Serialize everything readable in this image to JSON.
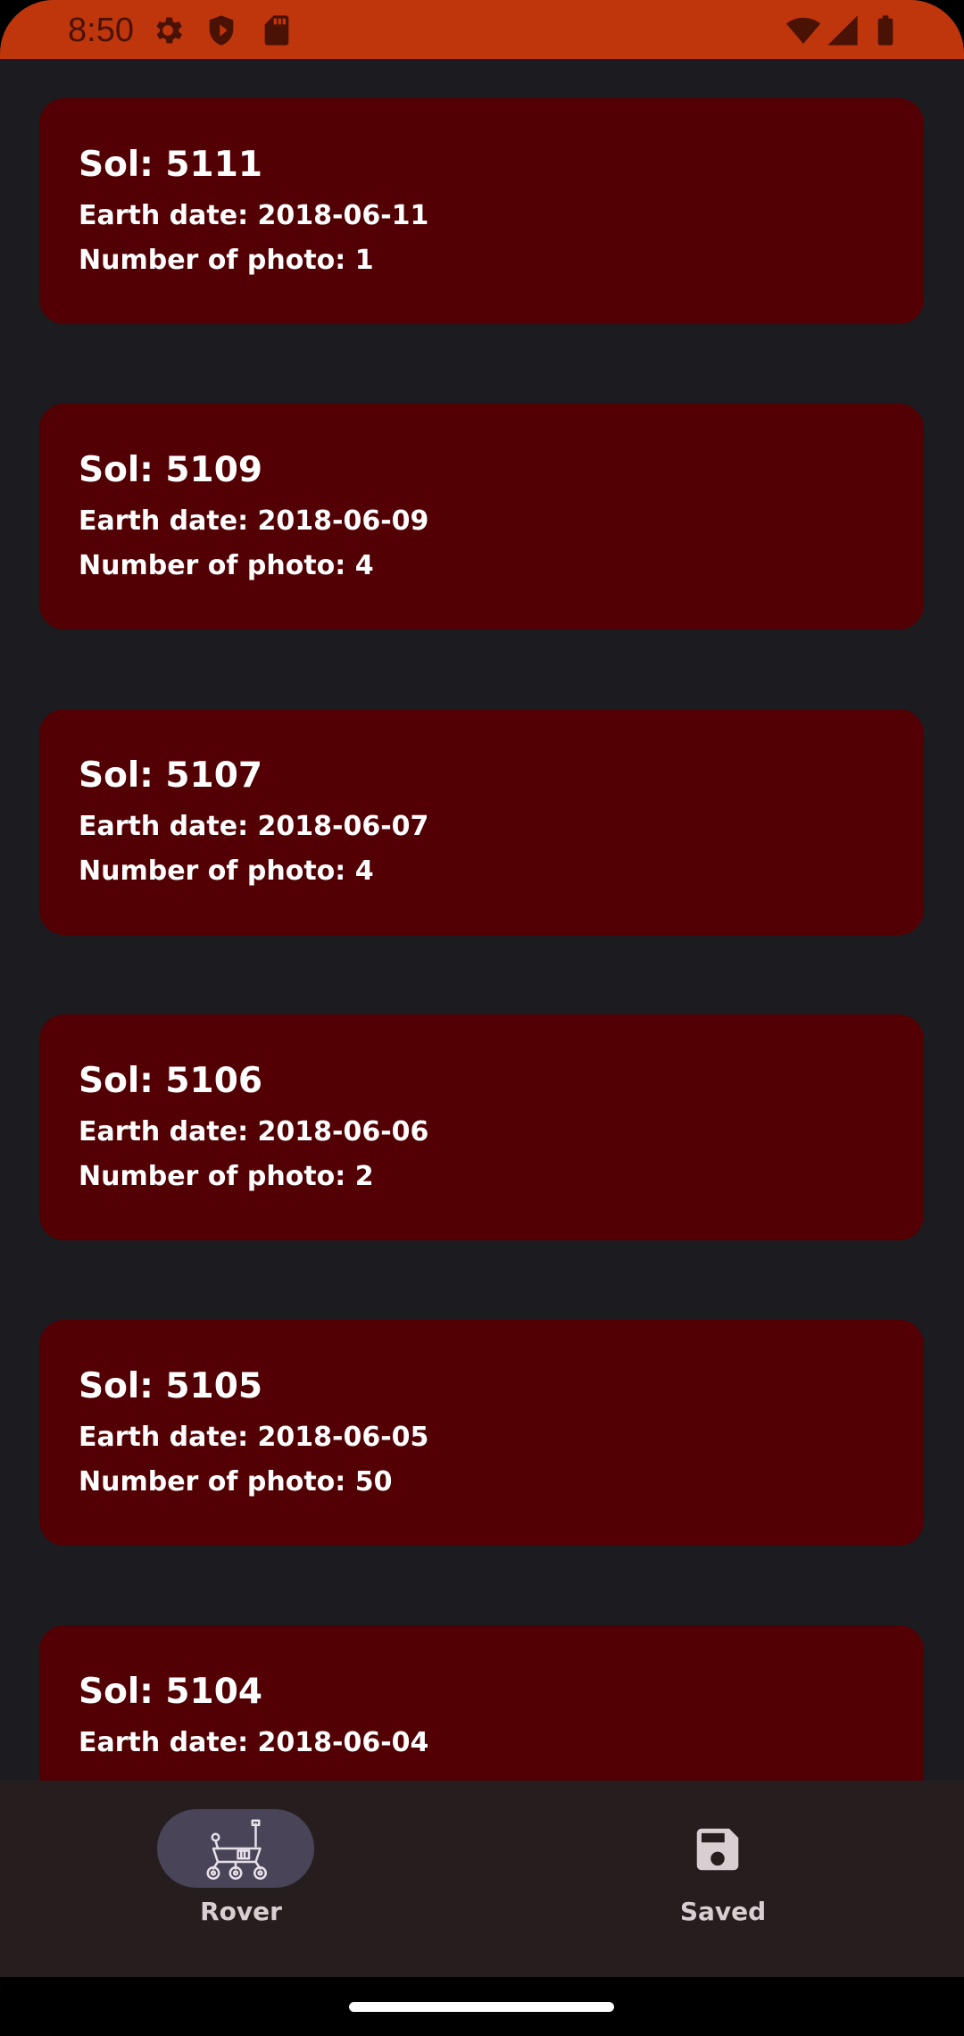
{
  "status_bar": {
    "time": "8:50",
    "icons_left": [
      "gear-icon",
      "shield-icon",
      "sd-card-icon"
    ],
    "icons_right": [
      "wifi-icon",
      "signal-icon",
      "battery-icon"
    ],
    "color": "#bf360c"
  },
  "sols": [
    {
      "sol": "Sol: 5111",
      "earth_date": "Earth date: 2018-06-11",
      "photos": "Number of photo: 1"
    },
    {
      "sol": "Sol: 5109",
      "earth_date": "Earth date: 2018-06-09",
      "photos": "Number of photo: 4"
    },
    {
      "sol": "Sol: 5107",
      "earth_date": "Earth date: 2018-06-07",
      "photos": "Number of photo: 4"
    },
    {
      "sol": "Sol: 5106",
      "earth_date": "Earth date: 2018-06-06",
      "photos": "Number of photo: 2"
    },
    {
      "sol": "Sol: 5105",
      "earth_date": "Earth date: 2018-06-05",
      "photos": "Number of photo: 50"
    },
    {
      "sol": "Sol: 5104",
      "earth_date": "Earth date: 2018-06-04",
      "photos": ""
    }
  ],
  "bottom_nav": {
    "items": [
      {
        "label": "Rover",
        "icon": "rover-icon",
        "selected": true
      },
      {
        "label": "Saved",
        "icon": "floppy-disk-icon",
        "selected": false
      }
    ]
  },
  "colors": {
    "background": "#1c1b1f",
    "card": "#520003",
    "nav_background": "#261d1e",
    "nav_pill": "#4a4458"
  }
}
